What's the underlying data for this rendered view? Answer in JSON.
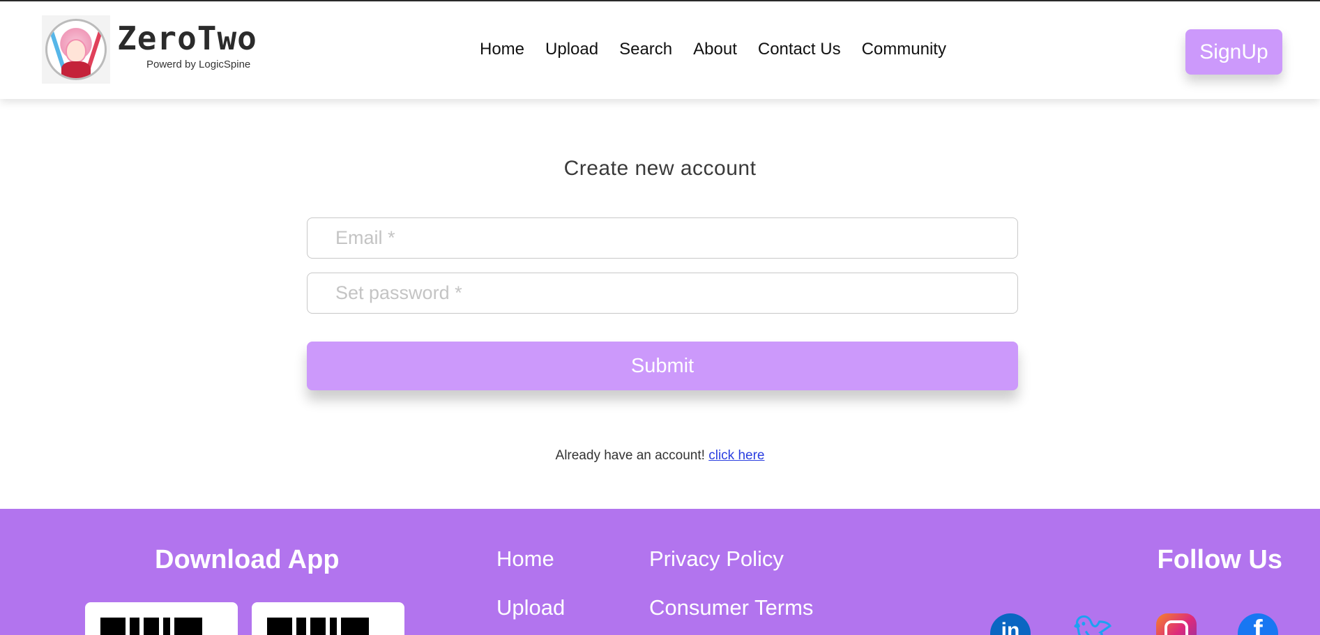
{
  "header": {
    "brand_name": "ZeroTwo",
    "brand_subtitle": "Powerd by LogicSpine",
    "nav": [
      "Home",
      "Upload",
      "Search",
      "About",
      "Contact Us",
      "Community"
    ],
    "signup_label": "SignUp"
  },
  "form": {
    "title": "Create new account",
    "email_placeholder": "Email *",
    "password_placeholder": "Set password *",
    "submit_label": "Submit",
    "already_text": "Already have an account!",
    "click_here": "click here"
  },
  "footer": {
    "download_title": "Download App",
    "links_col1": [
      "Home",
      "Upload"
    ],
    "links_col2": [
      "Privacy Policy",
      "Consumer Terms"
    ],
    "follow_title": "Follow Us",
    "socials": [
      "linkedin-icon",
      "twitter-icon",
      "instagram-icon",
      "facebook-icon"
    ]
  },
  "colors": {
    "accent": "#cc99fb",
    "footer_bg": "#b274ee",
    "link": "#2a3ee0"
  }
}
